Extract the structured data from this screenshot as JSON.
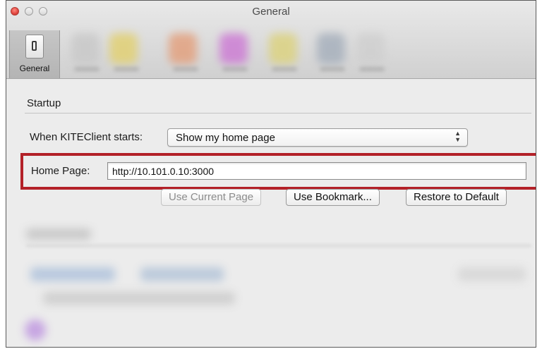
{
  "window": {
    "title": "General"
  },
  "toolbar": {
    "items": [
      {
        "label": "General",
        "selected": true,
        "icon": "general-switch-icon"
      }
    ],
    "blurred_item_colors": [
      "#c9c9c9",
      "#e6d36a",
      "#e49f78",
      "#cf7ad6",
      "#ded37a",
      "#a6b0bd",
      "#cfcfcf"
    ]
  },
  "startup": {
    "section_title": "Startup",
    "when_starts_label": "When KITEClient starts:",
    "when_starts_value": "Show my home page",
    "home_page_label": "Home Page:",
    "home_page_value": "http://10.101.0.10:3000",
    "buttons": {
      "use_current_page": "Use Current Page",
      "use_bookmark": "Use Bookmark...",
      "restore_default": "Restore to Default"
    }
  },
  "colors": {
    "highlight": "#b32128",
    "titlebar_top": "#e9e9e9",
    "titlebar_bottom": "#d0d0d0",
    "content_bg": "#ececec"
  }
}
